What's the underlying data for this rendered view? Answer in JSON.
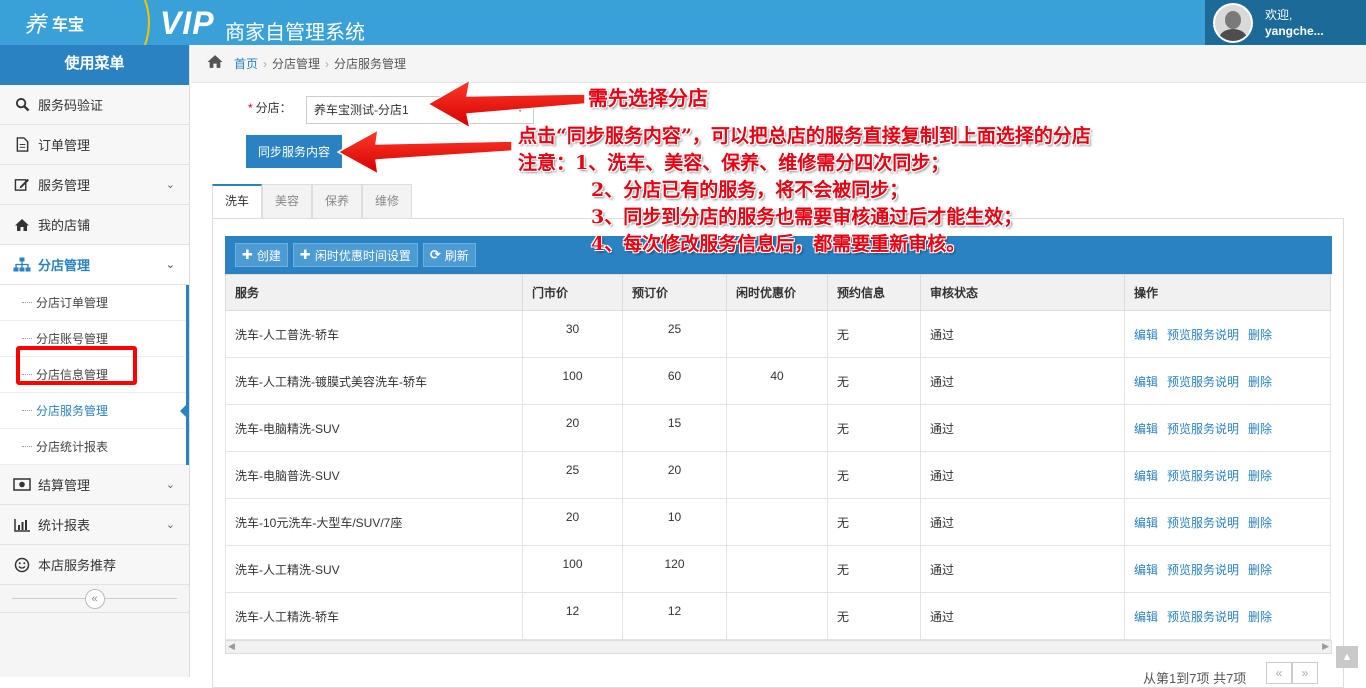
{
  "header": {
    "logo_text": "养",
    "brand_name": "车宝",
    "vip": "VIP",
    "system_name": "商家自管理系统",
    "greeting": "欢迎,",
    "username": "yangche..."
  },
  "sidebar": {
    "title": "使用菜单",
    "items": [
      {
        "label": "服务码验证",
        "icon": "search-icon"
      },
      {
        "label": "订单管理",
        "icon": "document-icon"
      },
      {
        "label": "服务管理",
        "icon": "edit-icon",
        "has_children": true
      },
      {
        "label": "我的店铺",
        "icon": "home-icon"
      },
      {
        "label": "分店管理",
        "icon": "sitemap-icon",
        "has_children": true,
        "expanded": true
      },
      {
        "label": "结算管理",
        "icon": "money-icon",
        "has_children": true
      },
      {
        "label": "统计报表",
        "icon": "bar-chart-icon",
        "has_children": true
      },
      {
        "label": "本店服务推荐",
        "icon": "smile-icon"
      }
    ],
    "sub_items": [
      {
        "label": "分店订单管理"
      },
      {
        "label": "分店账号管理"
      },
      {
        "label": "分店信息管理"
      },
      {
        "label": "分店服务管理",
        "selected": true
      },
      {
        "label": "分店统计报表"
      }
    ]
  },
  "breadcrumb": {
    "home": "首页",
    "level1": "分店管理",
    "level2": "分店服务管理"
  },
  "form": {
    "branch_label": "分店：",
    "required_mark": "*",
    "branch_value": "养车宝测试-分店1",
    "sync_button": "同步服务内容"
  },
  "tabs": [
    {
      "label": "洗车",
      "active": true
    },
    {
      "label": "美容"
    },
    {
      "label": "保养"
    },
    {
      "label": "维修"
    }
  ],
  "toolbar": {
    "create": "创建",
    "idle_time": "闲时优惠时间设置",
    "refresh": "刷新"
  },
  "table": {
    "columns": [
      "服务",
      "门市价",
      "预订价",
      "闲时优惠价",
      "预约信息",
      "审核状态",
      "操作"
    ],
    "rows": [
      {
        "service": "洗车-人工普洗-轿车",
        "market": "30",
        "booking": "25",
        "idle": "",
        "appointment": "无",
        "status": "通过"
      },
      {
        "service": "洗车-人工精洗-镀膜式美容洗车-轿车",
        "market": "100",
        "booking": "60",
        "idle": "40",
        "appointment": "无",
        "status": "通过"
      },
      {
        "service": "洗车-电脑精洗-SUV",
        "market": "20",
        "booking": "15",
        "idle": "",
        "appointment": "无",
        "status": "通过"
      },
      {
        "service": "洗车-电脑普洗-SUV",
        "market": "25",
        "booking": "20",
        "idle": "",
        "appointment": "无",
        "status": "通过"
      },
      {
        "service": "洗车-10元洗车-大型车/SUV/7座",
        "market": "20",
        "booking": "10",
        "idle": "",
        "appointment": "无",
        "status": "通过"
      },
      {
        "service": "洗车-人工精洗-SUV",
        "market": "100",
        "booking": "120",
        "idle": "",
        "appointment": "无",
        "status": "通过"
      },
      {
        "service": "洗车-人工精洗-轿车",
        "market": "12",
        "booking": "12",
        "idle": "",
        "appointment": "无",
        "status": "通过"
      }
    ],
    "ops": [
      "编辑",
      "预览服务说明",
      "删除"
    ]
  },
  "pager": {
    "info": "从第1到7项 共7项",
    "prev": "«",
    "next": "»"
  },
  "annotations": {
    "select_hint": "需先选择分店",
    "sync_hint": "点击“同步服务内容”，可以把总店的服务直接复制到上面选择的分店",
    "note1": "注意：1、洗车、美容、保养、维修需分四次同步；",
    "note2": "2、分店已有的服务，将不会被同步；",
    "note3": "3、同步到分店的服务也需要审核通过后才能生效；",
    "note4": "4、每次修改服务信息后，都需要重新审核。",
    "color": "#e60012"
  },
  "colors": {
    "topbar": "#3aa1d8",
    "primary": "#2b82c2",
    "user_box": "#1b6a97"
  }
}
